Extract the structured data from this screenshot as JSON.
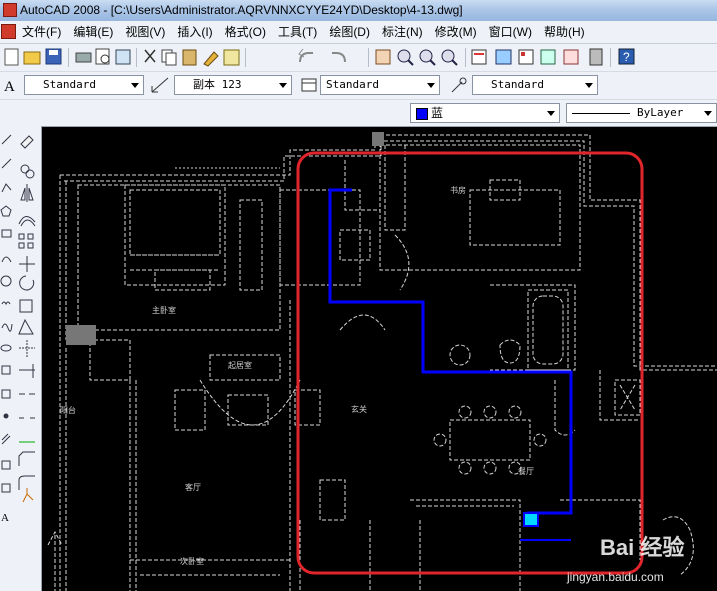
{
  "window": {
    "title": "AutoCAD 2008 - [C:\\Users\\Administrator.AQRVNNXCYYE24YD\\Desktop\\4-13.dwg]"
  },
  "menu": {
    "items": [
      {
        "label": "文件(F)"
      },
      {
        "label": "编辑(E)"
      },
      {
        "label": "视图(V)"
      },
      {
        "label": "插入(I)"
      },
      {
        "label": "格式(O)"
      },
      {
        "label": "工具(T)"
      },
      {
        "label": "绘图(D)"
      },
      {
        "label": "标注(N)"
      },
      {
        "label": "修改(M)"
      },
      {
        "label": "窗口(W)"
      },
      {
        "label": "帮助(H)"
      }
    ]
  },
  "styles_toolbar": {
    "text_style": "Standard",
    "dim_style": "副本 123",
    "table_style": "Standard",
    "multileader_style": "Standard"
  },
  "properties_toolbar": {
    "color": "蓝",
    "color_hex": "#0000ff",
    "linetype": "ByLayer"
  },
  "plan_labels": {
    "study": "书房",
    "master_bedroom": "主卧室",
    "living_room": "起居室",
    "dining_room": "餐厅",
    "balcony": "阳台",
    "lobby": "玄关",
    "hall": "客厅",
    "second_bedroom": "次卧室"
  },
  "watermark": {
    "brand": "Bai 经验",
    "url": "jingyan.baidu.com"
  },
  "colors": {
    "highlight_border": "#e0252b",
    "route_line": "#0000ff",
    "cad_lines": "#ffffff"
  }
}
